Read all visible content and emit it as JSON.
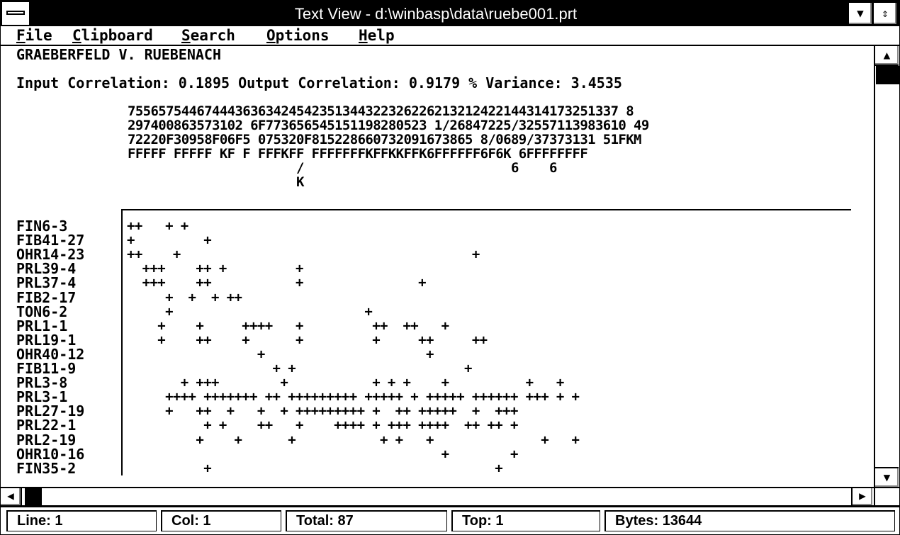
{
  "window": {
    "title": "Text View - d:\\winbasp\\data\\ruebe001.prt",
    "system_menu_icon": "system-menu-icon",
    "minimize_icon": "▼",
    "restore_icon": "⇕"
  },
  "menubar": {
    "items": [
      {
        "label": "File",
        "mnemonic": "F",
        "rest": "ile"
      },
      {
        "label": "Clipboard",
        "mnemonic": "C",
        "rest": "lipboard"
      },
      {
        "label": "Search",
        "mnemonic": "S",
        "rest": "earch"
      },
      {
        "label": "Options",
        "mnemonic": "O",
        "rest": "ptions"
      },
      {
        "label": "Help",
        "mnemonic": "H",
        "rest": "elp"
      }
    ]
  },
  "document": {
    "heading": "GRAEBERFELD V. RUEBENACH",
    "stats_line": "Input Correlation: 0.1895 Output Correlation: 0.9179 % Variance: 3.4535",
    "header_lines": [
      "7556575446744436363424542351344322326226213212422144314173251337 8",
      "297400863573102 6F773656545151198280523 1/26847225/32557113983610 49",
      "72220F30958F06F5 075320F815228660732091673865 8/0689/37373131 51FKM",
      "FFFFF FFFFF KF F FFFKFF FFFFFFFKFFKKFFK6FFFFFF6F6K 6FFFFFFFF",
      "                      /                           6    6",
      "                      K"
    ],
    "rows": [
      {
        "label": "FIN6-3",
        "marks": "++   + +"
      },
      {
        "label": "FIB41-27",
        "marks": "+         +"
      },
      {
        "label": "OHR14-23",
        "marks": "++    +                                      +"
      },
      {
        "label": "PRL39-4",
        "marks": "  +++    ++ +         +"
      },
      {
        "label": "PRL37-4",
        "marks": "  +++    ++           +               +"
      },
      {
        "label": "FIB2-17",
        "marks": "     +  +  + ++"
      },
      {
        "label": "TON6-2",
        "marks": "     +                         +"
      },
      {
        "label": "PRL1-1",
        "marks": "    +    +     ++++   +         ++  ++   +"
      },
      {
        "label": "PRL19-1",
        "marks": "    +    ++    +      +         +     ++     ++"
      },
      {
        "label": "OHR40-12",
        "marks": "                 +                     +"
      },
      {
        "label": "FIB11-9",
        "marks": "                   + +                      +"
      },
      {
        "label": "PRL3-8",
        "marks": "       + +++        +           + + +    +          +   +"
      },
      {
        "label": "PRL3-1",
        "marks": "     ++++ +++++++ ++ +++++++++ +++++ + +++++ ++++++ +++ + +"
      },
      {
        "label": "PRL27-19",
        "marks": "     +   ++  +   +  + +++++++++ +  ++ +++++  +  +++"
      },
      {
        "label": "PRL22-1",
        "marks": "          + +    ++   +    ++++ + +++ ++++  ++ ++ +"
      },
      {
        "label": "PRL2-19",
        "marks": "         +    +      +           + +   +              +   +"
      },
      {
        "label": "OHR10-16",
        "marks": "                                         +        +"
      },
      {
        "label": "FIN35-2",
        "marks": "          +                                     +"
      }
    ]
  },
  "scrollbars": {
    "up_icon": "▲",
    "down_icon": "▼",
    "left_icon": "◀",
    "right_icon": "▶",
    "vertical_position": 0,
    "horizontal_position": 0
  },
  "statusbar": {
    "line": "Line: 1",
    "col": "Col: 1",
    "total": "Total: 87",
    "top": "Top: 1",
    "bytes": "Bytes: 13644"
  }
}
